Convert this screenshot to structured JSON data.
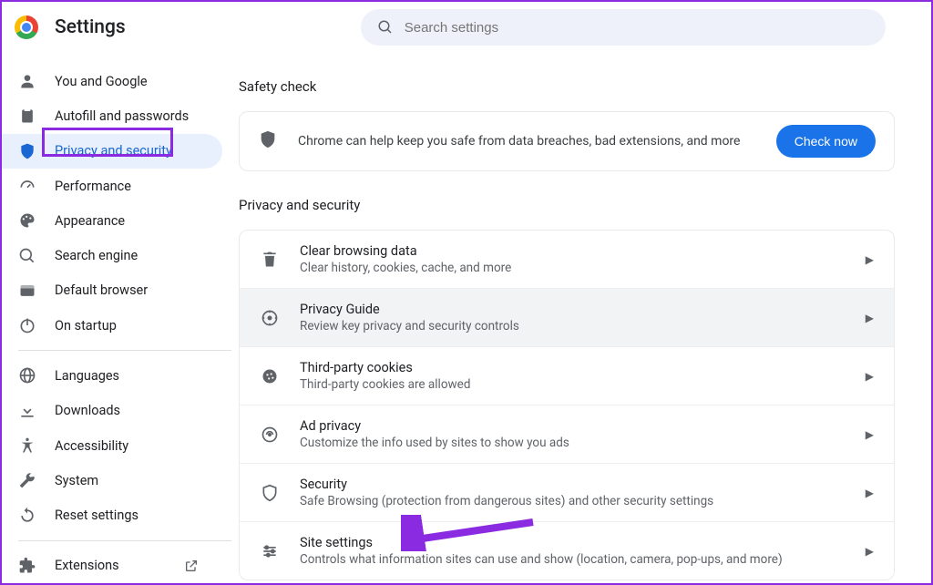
{
  "app": {
    "title": "Settings"
  },
  "search": {
    "placeholder": "Search settings"
  },
  "sidebar": {
    "items": [
      {
        "label": "You and Google",
        "icon": "person-icon"
      },
      {
        "label": "Autofill and passwords",
        "icon": "clipboard-icon"
      },
      {
        "label": "Privacy and security",
        "icon": "shield-icon",
        "active": true,
        "highlighted": true
      },
      {
        "label": "Performance",
        "icon": "speedometer-icon"
      },
      {
        "label": "Appearance",
        "icon": "palette-icon"
      },
      {
        "label": "Search engine",
        "icon": "search-icon"
      },
      {
        "label": "Default browser",
        "icon": "browser-icon"
      },
      {
        "label": "On startup",
        "icon": "power-icon"
      }
    ],
    "secondary_items": [
      {
        "label": "Languages",
        "icon": "globe-icon"
      },
      {
        "label": "Downloads",
        "icon": "download-icon"
      },
      {
        "label": "Accessibility",
        "icon": "accessibility-icon"
      },
      {
        "label": "System",
        "icon": "wrench-icon"
      },
      {
        "label": "Reset settings",
        "icon": "reset-icon"
      }
    ],
    "footer": {
      "label": "Extensions",
      "icon": "extension-icon"
    }
  },
  "main": {
    "safety_heading": "Safety check",
    "safety_card": {
      "icon": "shield-filled-icon",
      "description": "Chrome can help keep you safe from data breaches, bad extensions, and more",
      "button": "Check now"
    },
    "privacy_heading": "Privacy and security",
    "rows": [
      {
        "icon": "trash-icon",
        "title": "Clear browsing data",
        "subtitle": "Clear history, cookies, cache, and more"
      },
      {
        "icon": "compass-icon",
        "title": "Privacy Guide",
        "subtitle": "Review key privacy and security controls",
        "hover": true
      },
      {
        "icon": "cookie-icon",
        "title": "Third-party cookies",
        "subtitle": "Third-party cookies are allowed"
      },
      {
        "icon": "ad-privacy-icon",
        "title": "Ad privacy",
        "subtitle": "Customize the info used by sites to show you ads"
      },
      {
        "icon": "shield-outline-icon",
        "title": "Security",
        "subtitle": "Safe Browsing (protection from dangerous sites) and other security settings"
      },
      {
        "icon": "sliders-icon",
        "title": "Site settings",
        "subtitle": "Controls what information sites can use and show (location, camera, pop-ups, and more)",
        "annotated": true
      }
    ]
  },
  "accent_color": "#1a73e8",
  "annotation_color": "#8a2be2"
}
